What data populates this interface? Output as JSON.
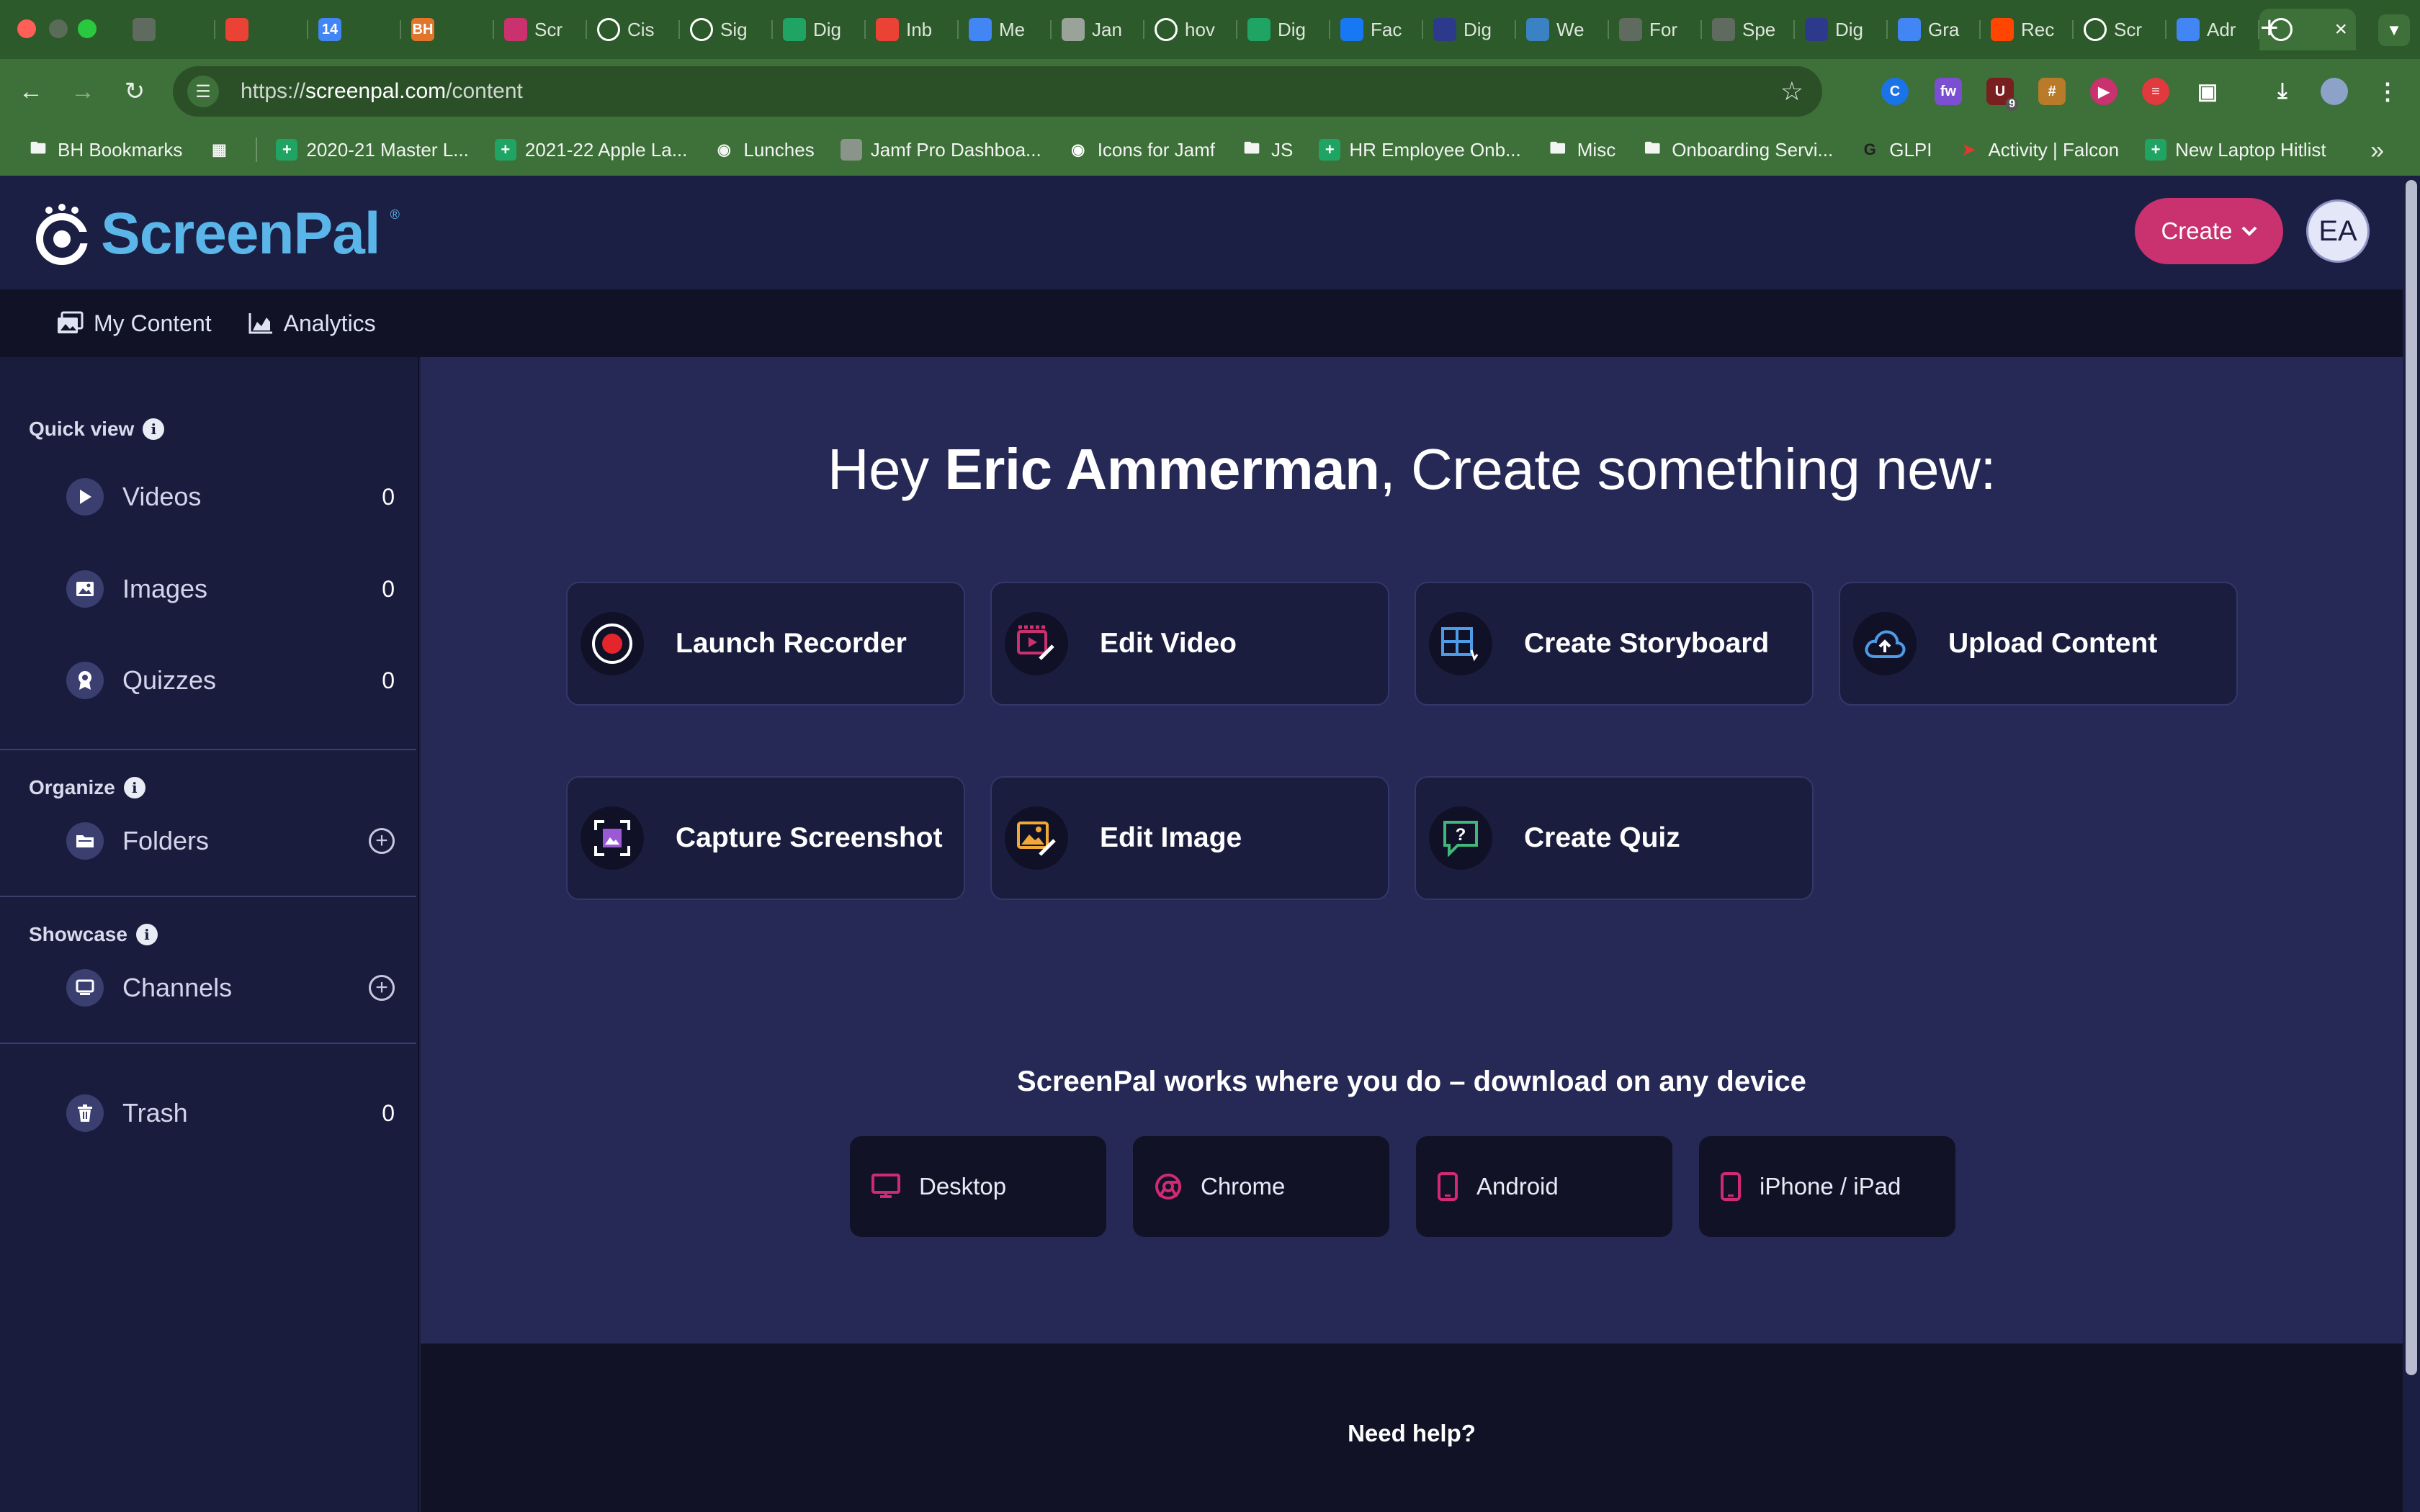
{
  "browser": {
    "tabs": [
      {
        "label": "",
        "icon": "globe-icon",
        "color": "#5f6b5e"
      },
      {
        "label": "",
        "icon": "gmail-icon",
        "color": "#ea4335"
      },
      {
        "label": "",
        "icon": "calendar-icon",
        "color": "#4285f4",
        "badge": "14"
      },
      {
        "label": "",
        "icon": "bh-icon",
        "color": "#e0752b",
        "badge": "BH"
      },
      {
        "label": "Scr",
        "icon": "screenpal-icon",
        "color": "#c9316f"
      },
      {
        "label": "Cis",
        "icon": "cisco-icon",
        "color": "#ffffff"
      },
      {
        "label": "Sig",
        "icon": "cisco-icon",
        "color": "#ffffff"
      },
      {
        "label": "Dig",
        "icon": "drive-icon",
        "color": "#1fa463"
      },
      {
        "label": "Inb",
        "icon": "gmail-icon",
        "color": "#ea4335"
      },
      {
        "label": "Me",
        "icon": "meet-icon",
        "color": "#4285f4"
      },
      {
        "label": "Jan",
        "icon": "page-icon",
        "color": "#9aa39a"
      },
      {
        "label": "hov",
        "icon": "google-icon",
        "color": "#ffffff"
      },
      {
        "label": "Dig",
        "icon": "drive-icon",
        "color": "#1fa463"
      },
      {
        "label": "Fac",
        "icon": "facebook-icon",
        "color": "#1877f2"
      },
      {
        "label": "Dig",
        "icon": "digicert-icon",
        "color": "#2d3a8c"
      },
      {
        "label": "We",
        "icon": "sp-icon",
        "color": "#3b82c4"
      },
      {
        "label": "For",
        "icon": "globe-icon",
        "color": "#5f6b5e"
      },
      {
        "label": "Spe",
        "icon": "globe-icon",
        "color": "#5f6b5e"
      },
      {
        "label": "Dig",
        "icon": "digicert-icon",
        "color": "#2d3a8c"
      },
      {
        "label": "Gra",
        "icon": "admin-icon",
        "color": "#4285f4"
      },
      {
        "label": "Rec",
        "icon": "reddit-icon",
        "color": "#ff4500"
      },
      {
        "label": "Scr",
        "icon": "screenpal-icon",
        "color": "#ffffff"
      },
      {
        "label": "Adr",
        "icon": "admin-icon",
        "color": "#4285f4"
      },
      {
        "label": "",
        "icon": "screenpal-icon",
        "color": "#ffffff",
        "active": true
      }
    ],
    "url_prefix": "https://",
    "url_host": "screenpal.com",
    "url_path": "/content",
    "bookmarks": [
      {
        "label": "BH Bookmarks",
        "icon": "folder-icon"
      },
      {
        "label": "",
        "icon": "apps-grid-icon"
      },
      {
        "label": "2020-21 Master L...",
        "icon": "sheets-icon"
      },
      {
        "label": "2021-22 Apple La...",
        "icon": "sheets-icon"
      },
      {
        "label": "Lunches",
        "icon": "globe-icon"
      },
      {
        "label": "Jamf Pro Dashboa...",
        "icon": "page-icon"
      },
      {
        "label": "Icons for Jamf",
        "icon": "github-icon"
      },
      {
        "label": "JS",
        "icon": "folder-icon"
      },
      {
        "label": "HR Employee Onb...",
        "icon": "sheets-icon"
      },
      {
        "label": "Misc",
        "icon": "folder-icon"
      },
      {
        "label": "Onboarding Servi...",
        "icon": "folder-icon"
      },
      {
        "label": "GLPI",
        "icon": "glpi-icon"
      },
      {
        "label": "Activity | Falcon",
        "icon": "falcon-icon"
      },
      {
        "label": "New Laptop Hitlist",
        "icon": "sheets-icon"
      }
    ],
    "ext_badge": "9"
  },
  "header": {
    "logo_text": "ScreenPal",
    "logo_reg": "®",
    "create_label": "Create",
    "avatar_initials": "EA"
  },
  "subnav": {
    "my_content": "My Content",
    "analytics": "Analytics"
  },
  "sidebar": {
    "quick_view": "Quick view",
    "videos": {
      "label": "Videos",
      "count": "0"
    },
    "images": {
      "label": "Images",
      "count": "0"
    },
    "quizzes": {
      "label": "Quizzes",
      "count": "0"
    },
    "organize": "Organize",
    "folders": {
      "label": "Folders"
    },
    "showcase": "Showcase",
    "channels": {
      "label": "Channels"
    },
    "trash": {
      "label": "Trash",
      "count": "0"
    }
  },
  "main": {
    "greeting_prefix": "Hey ",
    "user_name": "Eric Ammerman",
    "greeting_suffix": ", Create something new:",
    "actions": {
      "launch_recorder": "Launch Recorder",
      "edit_video": "Edit Video",
      "create_storyboard": "Create Storyboard",
      "upload_content": "Upload Content",
      "capture_screenshot": "Capture Screenshot",
      "edit_image": "Edit Image",
      "create_quiz": "Create Quiz"
    },
    "download_title": "ScreenPal works where you do – download on any device",
    "downloads": {
      "desktop": "Desktop",
      "chrome": "Chrome",
      "android": "Android",
      "iphone": "iPhone / iPad"
    }
  },
  "footer": {
    "help": "Need help?"
  },
  "colors": {
    "accent": "#c9316f",
    "brand_blue": "#5ab6e9",
    "background": "#262955"
  }
}
